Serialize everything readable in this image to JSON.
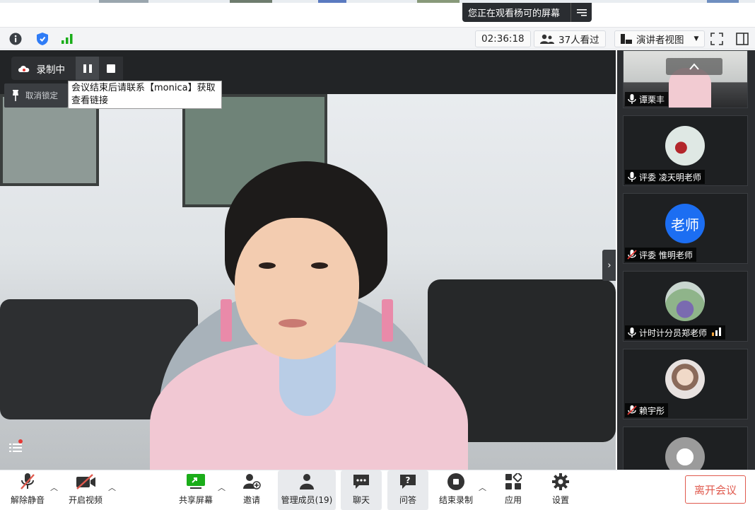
{
  "banner": {
    "text": "您正在观看杨可的屏幕",
    "menu_icon": "menu-lines-icon"
  },
  "statusbar": {
    "timer": "02:36:18",
    "viewers": "37人看过",
    "layout": "演讲者视图",
    "icons": [
      "info-icon",
      "shield-icon",
      "signal-icon",
      "fullscreen-icon",
      "sidebar-icon"
    ],
    "colors": {
      "info": "#3a3f45",
      "shield": "#2f7cf6",
      "signal": "#1aad19"
    }
  },
  "recording": {
    "label": "录制中",
    "unlock": "取消锁定",
    "tooltip": "会议结束后请联系【monica】获取查看链接"
  },
  "participants": [
    {
      "name": "谭栗丰",
      "muted": false,
      "avatar": "photo"
    },
    {
      "name": "评委 凌天明老师",
      "muted": false,
      "avatar": "photo"
    },
    {
      "name": "评委 惟明老师",
      "muted": true,
      "avatar": "text",
      "avatar_text": "老师",
      "avatar_color": "#1c6ef2"
    },
    {
      "name": "计时计分员郑老师",
      "muted": false,
      "avatar": "photo",
      "signal": true
    },
    {
      "name": "赖宇彤",
      "muted": true,
      "avatar": "photo"
    },
    {
      "name": "",
      "muted": false,
      "avatar": "photo"
    }
  ],
  "toolbar": {
    "unmute": "解除静音",
    "start_video": "开启视频",
    "share_screen": "共享屏幕",
    "invite": "邀请",
    "manage_members": "管理成员(19)",
    "chat": "聊天",
    "qa": "问答",
    "end_record": "结束录制",
    "apps": "应用",
    "settings": "设置",
    "leave": "离开会议",
    "accent": "#e05a4e"
  }
}
